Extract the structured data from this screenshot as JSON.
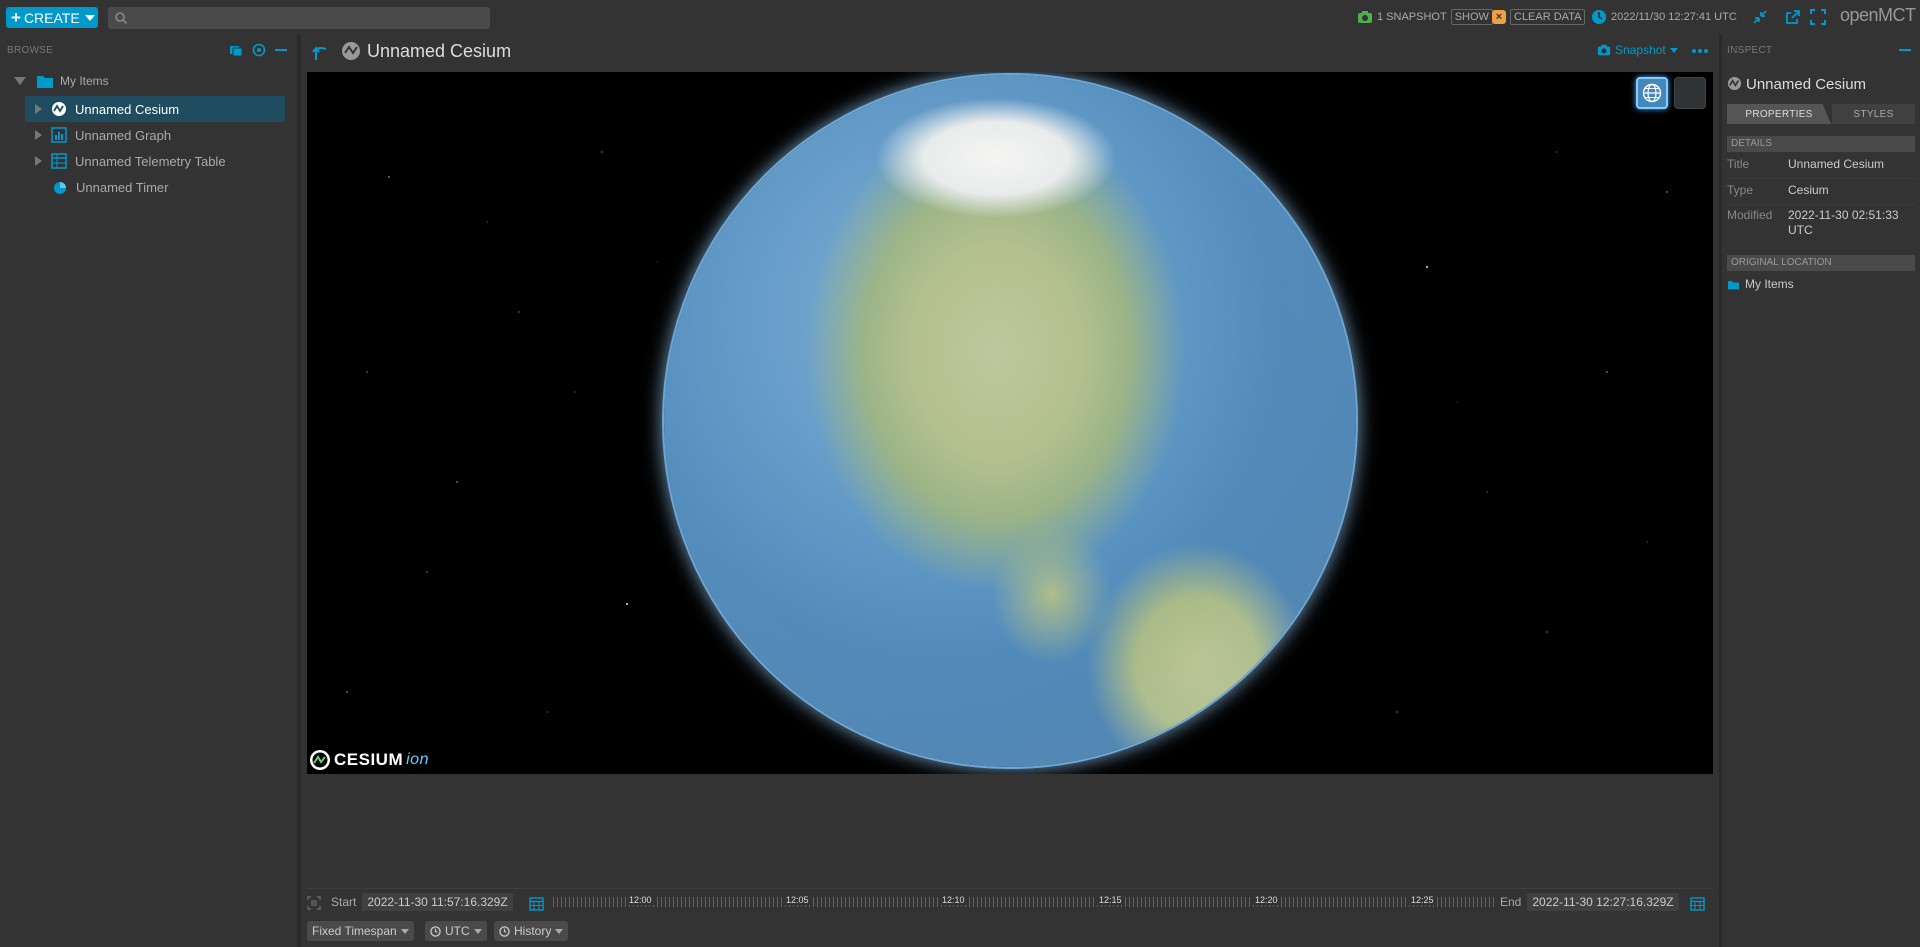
{
  "header": {
    "create_label": "CREATE",
    "search_placeholder": "",
    "snapshot_count": "1 SNAPSHOT",
    "show_label": "SHOW",
    "clear_data_label": "CLEAR DATA",
    "clock_text": "2022/11/30 12:27:41 UTC",
    "brand": "openMCT"
  },
  "browse": {
    "label": "BROWSE",
    "root": "My Items",
    "items": [
      {
        "label": "Unnamed Cesium",
        "icon": "cesium-icon",
        "selected": true
      },
      {
        "label": "Unnamed Graph",
        "icon": "graph-icon"
      },
      {
        "label": "Unnamed Telemetry Table",
        "icon": "table-icon"
      },
      {
        "label": "Unnamed Timer",
        "icon": "timer-icon"
      }
    ]
  },
  "main": {
    "title": "Unnamed Cesium",
    "snapshot_label": "Snapshot",
    "cesium_logo": "CESIUM",
    "cesium_logo_suffix": "ion"
  },
  "time_conductor": {
    "start_label": "Start",
    "start_value": "2022-11-30 11:57:16.329Z",
    "end_label": "End",
    "end_value": "2022-11-30 12:27:16.329Z",
    "ticks": [
      "12:00",
      "12:05",
      "12:10",
      "12:15",
      "12:20",
      "12:25"
    ],
    "mode": "Fixed Timespan",
    "timesystem": "UTC",
    "history": "History"
  },
  "inspector": {
    "label": "INSPECT",
    "title": "Unnamed Cesium",
    "tabs": [
      "PROPERTIES",
      "STYLES"
    ],
    "details_header": "DETAILS",
    "props": [
      {
        "key": "Title",
        "value": "Unnamed Cesium"
      },
      {
        "key": "Type",
        "value": "Cesium"
      },
      {
        "key": "Modified",
        "value": "2022-11-30 02:51:33 UTC"
      }
    ],
    "location_header": "ORIGINAL LOCATION",
    "location": "My Items"
  },
  "colors": {
    "accent": "#0099cc",
    "selected_row": "#1f4c5e",
    "background": "#333333",
    "snapshot_green": "#4caf50",
    "clear_orange": "#f0a040"
  }
}
